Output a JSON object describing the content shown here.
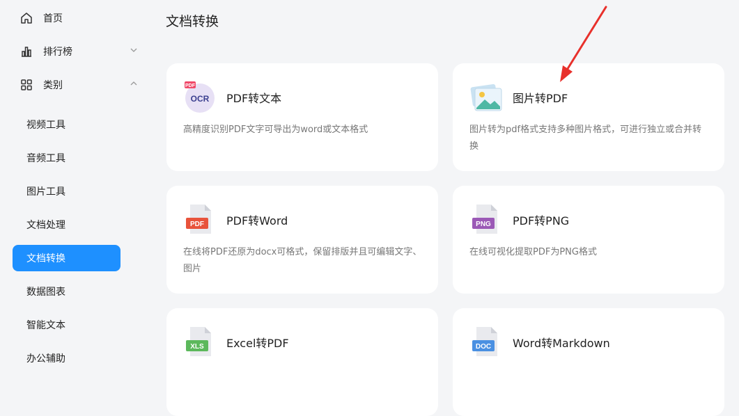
{
  "sidebar": {
    "top_items": [
      {
        "label": "首页",
        "icon": "home-icon",
        "chevron": ""
      },
      {
        "label": "排行榜",
        "icon": "bar-chart-icon",
        "chevron": "down"
      },
      {
        "label": "类别",
        "icon": "grid-icon",
        "chevron": "up"
      }
    ],
    "sub_items": [
      {
        "label": "视频工具",
        "active": false
      },
      {
        "label": "音频工具",
        "active": false
      },
      {
        "label": "图片工具",
        "active": false
      },
      {
        "label": "文档处理",
        "active": false
      },
      {
        "label": "文档转换",
        "active": true
      },
      {
        "label": "数据图表",
        "active": false
      },
      {
        "label": "智能文本",
        "active": false
      },
      {
        "label": "办公辅助",
        "active": false
      }
    ],
    "active_color": "#1e90ff"
  },
  "main": {
    "title": "文档转换",
    "cards": [
      {
        "title": "PDF转文本",
        "desc": "高精度识别PDF文字可导出为word或文本格式",
        "icon": "ocr-icon",
        "badge": "OCR",
        "corner_badge": "PDF"
      },
      {
        "title": "图片转PDF",
        "desc": "图片转为pdf格式支持多种图片格式，可进行独立或合并转换",
        "icon": "image-icon"
      },
      {
        "title": "PDF转Word",
        "desc": "在线将PDF还原为docx可格式，保留排版并且可编辑文字、图片",
        "icon": "pdf-file-icon",
        "badge": "PDF",
        "badge_color": "#e8533b"
      },
      {
        "title": "PDF转PNG",
        "desc": "在线可视化提取PDF为PNG格式",
        "icon": "png-file-icon",
        "badge": "PNG",
        "badge_color": "#9b59b6"
      },
      {
        "title": "Excel转PDF",
        "desc": "",
        "icon": "xls-file-icon",
        "badge": "XLS",
        "badge_color": "#5cb85c"
      },
      {
        "title": "Word转Markdown",
        "desc": "",
        "icon": "doc-file-icon",
        "badge": "DOC",
        "badge_color": "#4a90e2"
      }
    ]
  },
  "annotation": {
    "color": "#e8302b"
  }
}
